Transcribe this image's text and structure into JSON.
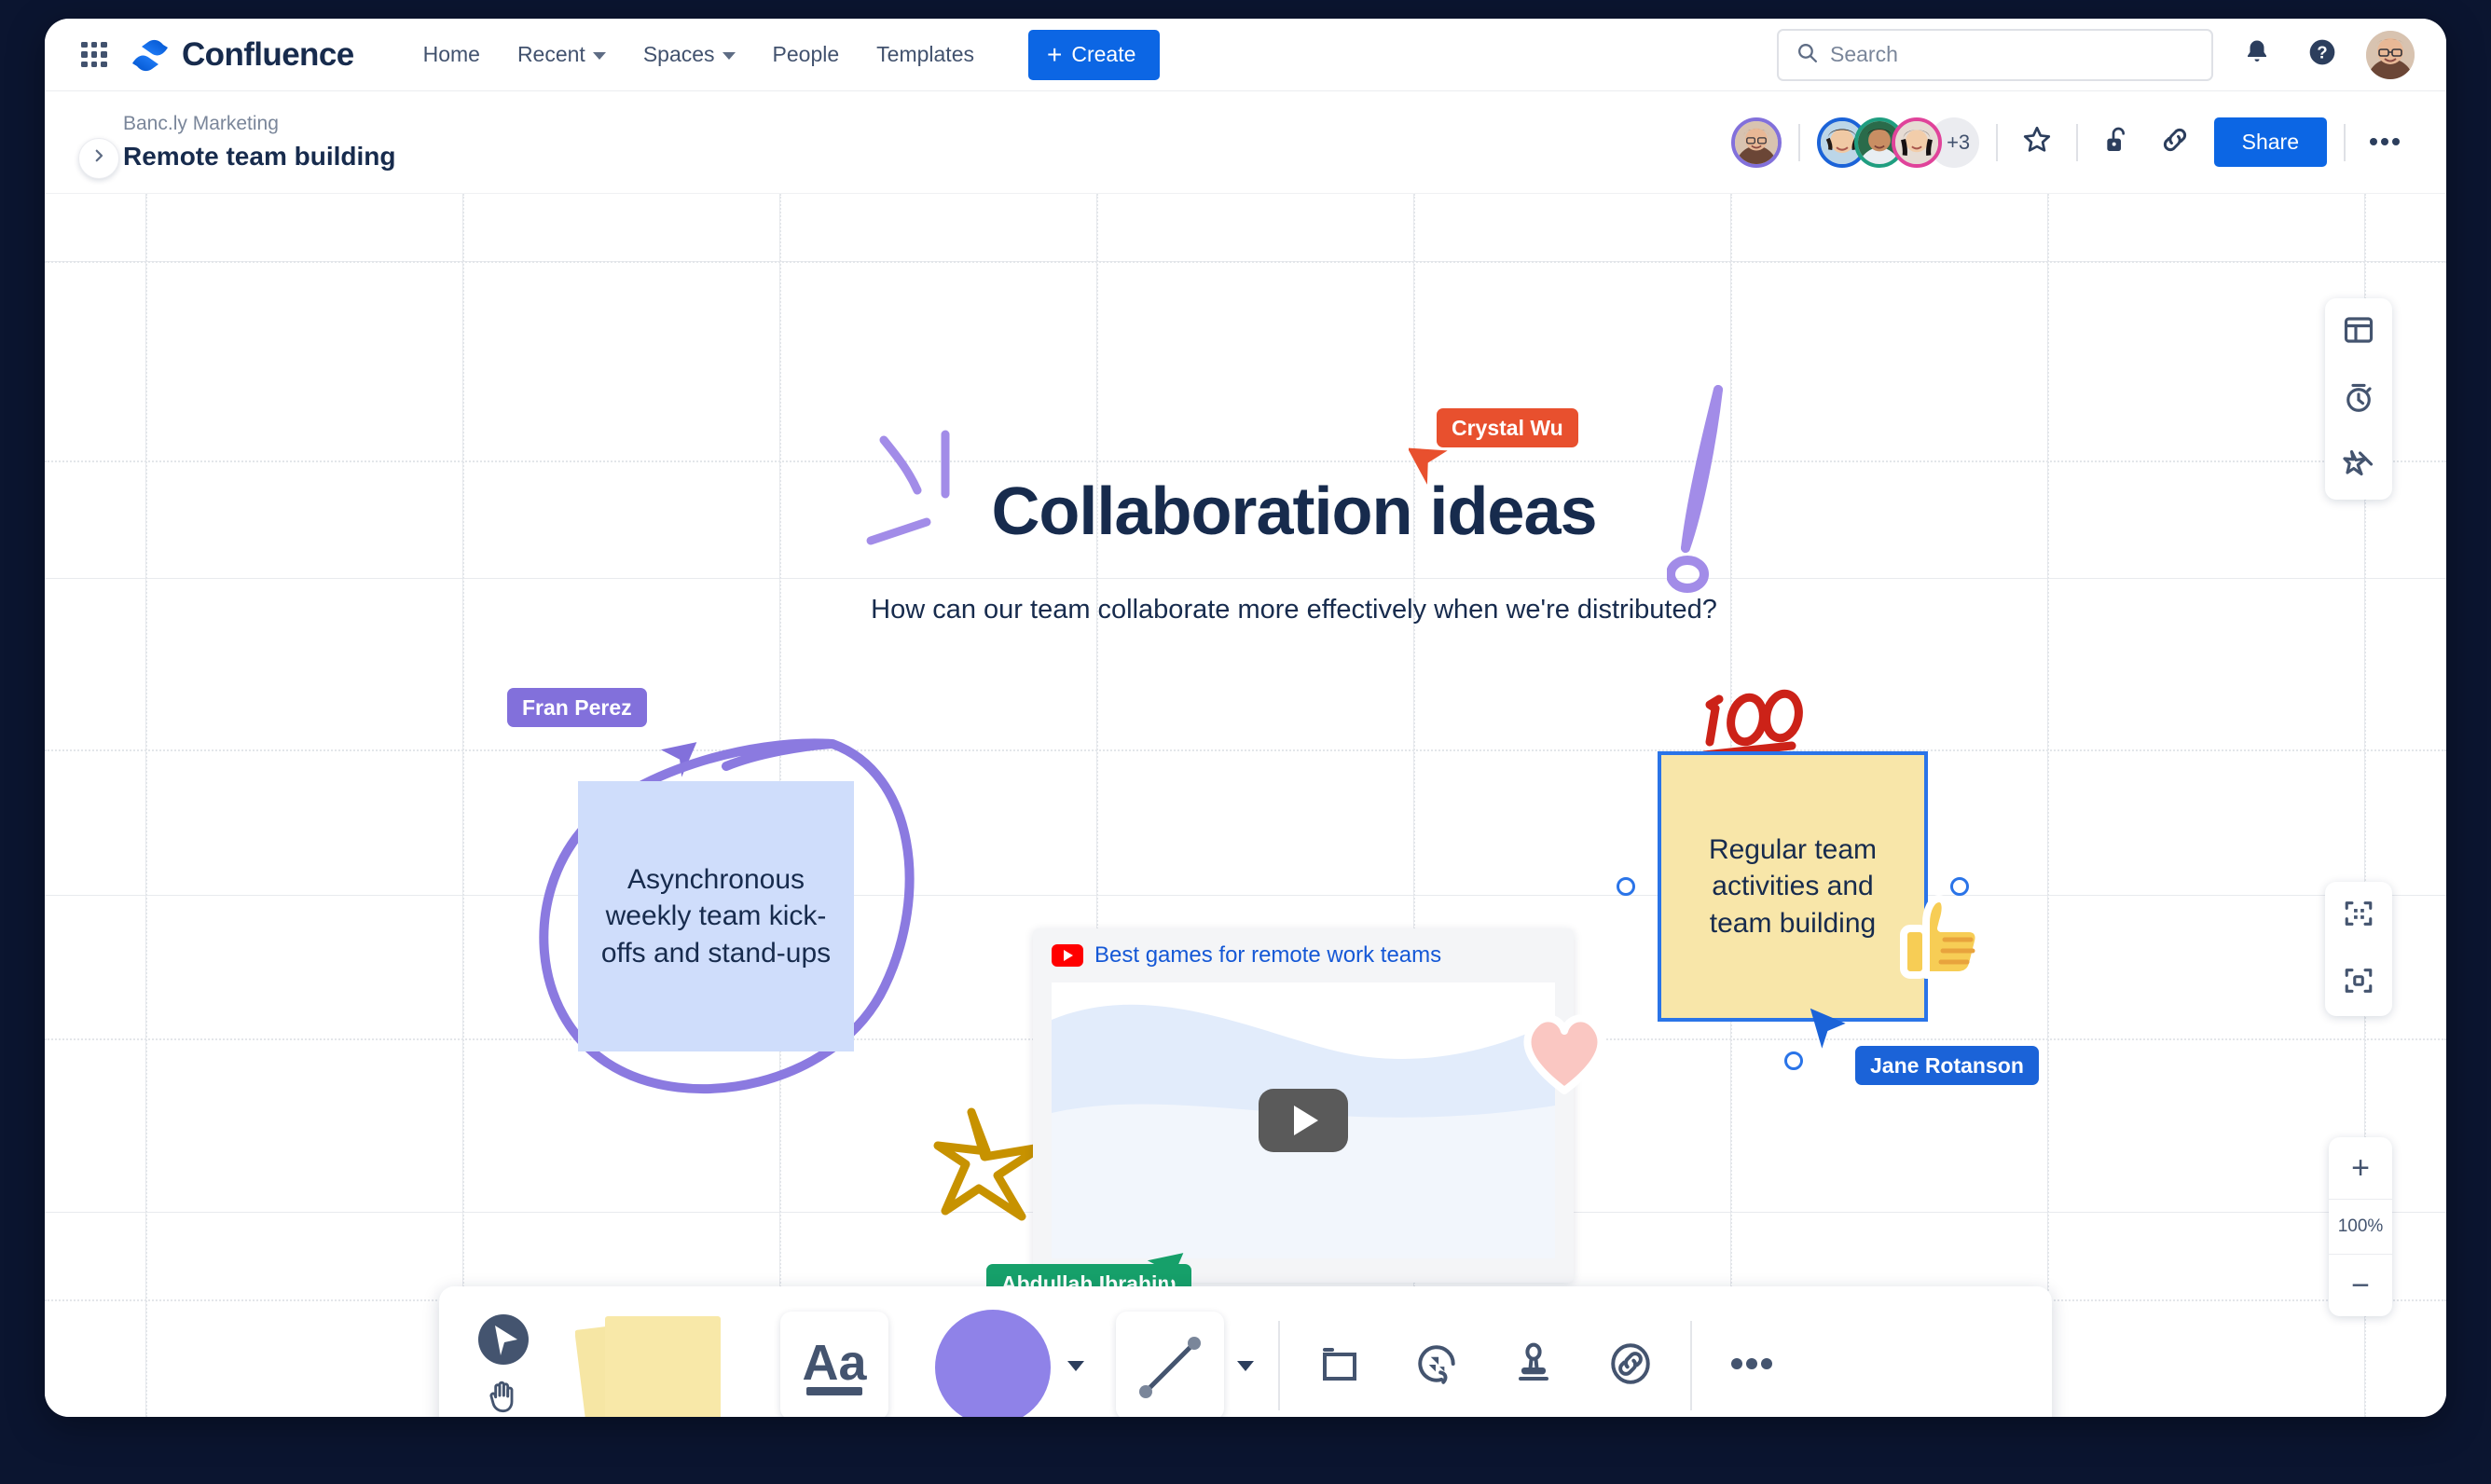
{
  "nav": {
    "brand": "Confluence",
    "app_switcher_icon": "grid-apps-icon",
    "links": [
      {
        "label": "Home",
        "has_caret": false
      },
      {
        "label": "Recent",
        "has_caret": true
      },
      {
        "label": "Spaces",
        "has_caret": true
      },
      {
        "label": "People",
        "has_caret": false
      },
      {
        "label": "Templates",
        "has_caret": false
      }
    ],
    "create_label": "Create",
    "create_plus": "+",
    "search_placeholder": "Search",
    "search_value": "",
    "notifications_icon": "bell-icon",
    "help_icon": "question-circle-icon",
    "profile_icon": "user-avatar"
  },
  "pagebar": {
    "breadcrumb": "Banc.ly Marketing",
    "title": "Remote team building",
    "collapse_icon": "chevron-right-icon",
    "avatar_more_count": "+3",
    "star_icon": "star-icon",
    "restrictions_icon": "unlock-icon",
    "copy_link_icon": "link-icon",
    "share_label": "Share",
    "more_icon": "ellipsis-icon"
  },
  "whiteboard": {
    "title": "Collaboration ideas",
    "subtitle": "How can our team collaborate more effectively when we're distributed?",
    "sticky_notes": [
      {
        "text": "Asynchronous weekly team kick-offs and stand-ups",
        "color": "#cfddfb"
      },
      {
        "text": "Regular team activities and team building",
        "color": "#f8e6a9",
        "selected": true
      }
    ],
    "video": {
      "source_icon": "youtube-icon",
      "title": "Best games for remote work teams",
      "play_icon": "play-button-icon"
    },
    "cursors": [
      {
        "name": "Crystal Wu",
        "color": "#e8502e"
      },
      {
        "name": "Fran Perez",
        "color": "#8270db"
      },
      {
        "name": "Jane Rotanson",
        "color": "#1b63d8"
      },
      {
        "name": "Abdullah Ibrahim",
        "color": "#16a06a"
      }
    ],
    "stickers": [
      {
        "name": "hundred-points-sticker"
      },
      {
        "name": "thumbs-up-sticker"
      },
      {
        "name": "heart-sticker"
      }
    ],
    "doodles": [
      {
        "name": "exclamation-mark-doodle",
        "color": "#a28ce8"
      },
      {
        "name": "sparkle-lines-doodle",
        "color": "#a28ce8"
      },
      {
        "name": "circle-highlight-doodle",
        "color": "#8b7ae0"
      },
      {
        "name": "star-doodle",
        "color": "#c79200"
      }
    ]
  },
  "side_panel": {
    "buttons": [
      {
        "icon": "layout-template-icon",
        "name": "templates-panel-button"
      },
      {
        "icon": "timer-icon",
        "name": "timer-button"
      },
      {
        "icon": "sparkle-star-icon",
        "name": "ai-button"
      }
    ]
  },
  "view_controls": {
    "buttons": [
      {
        "icon": "fit-to-screen-icon",
        "name": "fit-to-screen-button"
      },
      {
        "icon": "zoom-to-selection-icon",
        "name": "zoom-to-selection-button"
      }
    ]
  },
  "zoom_controls": {
    "zoom_in": "+",
    "zoom_level": "100%",
    "zoom_out": "−"
  },
  "toolbar": {
    "items": [
      {
        "name": "select-tool",
        "icon": "cursor-arrow-icon"
      },
      {
        "name": "hand-tool",
        "icon": "hand-icon"
      },
      {
        "name": "sticky-note-tool",
        "icon": "sticky-notes-icon"
      },
      {
        "name": "text-tool",
        "icon": "text-aa-icon",
        "label": "Aa"
      },
      {
        "name": "shape-tool",
        "icon": "circle-shape-icon"
      },
      {
        "name": "line-tool",
        "icon": "line-connector-icon"
      },
      {
        "name": "frame-tool",
        "icon": "frame-icon"
      },
      {
        "name": "jira-tool",
        "icon": "jira-smart-link-icon"
      },
      {
        "name": "stamp-tool",
        "icon": "stamp-icon"
      },
      {
        "name": "link-tool",
        "icon": "link-circle-icon"
      },
      {
        "name": "more-tools",
        "icon": "ellipsis-icon"
      }
    ]
  }
}
